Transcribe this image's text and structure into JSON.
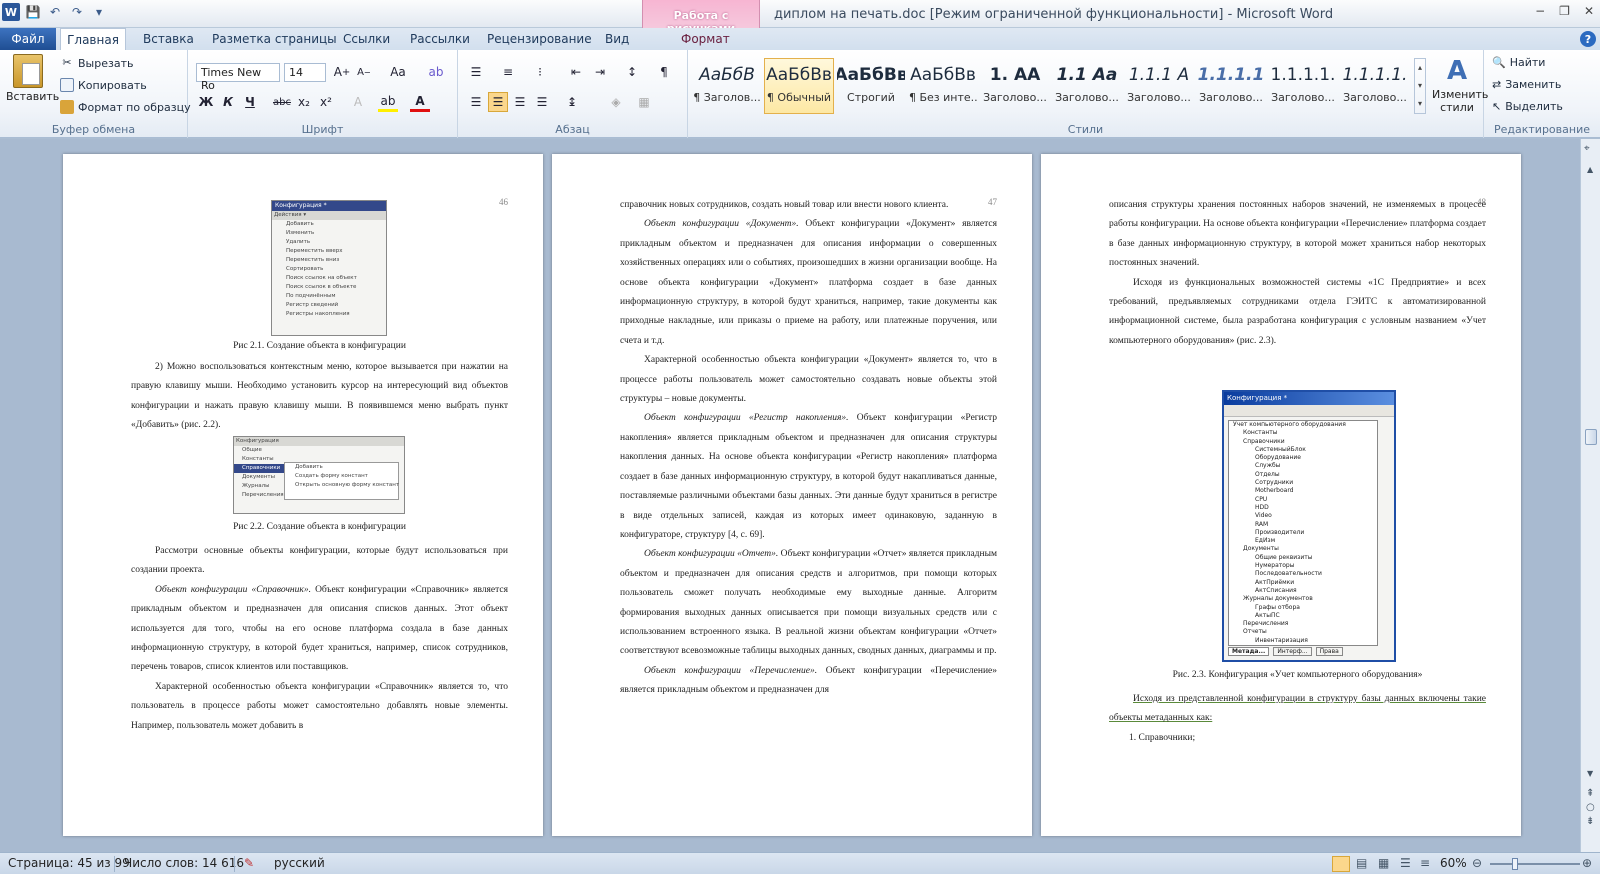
{
  "window": {
    "title": "диплом на печать.doc [Режим ограниченной функциональности]  -  Microsoft Word",
    "context_tab_group": "Работа с рисунками",
    "context_tab": "Формат",
    "controls": [
      "−",
      "❐",
      "✕"
    ]
  },
  "tabs": [
    "Файл",
    "Главная",
    "Вставка",
    "Разметка страницы",
    "Ссылки",
    "Рассылки",
    "Рецензирование",
    "Вид"
  ],
  "ribbon": {
    "clipboard": {
      "paste": "Вставить",
      "cut": "Вырезать",
      "copy": "Копировать",
      "format_painter": "Формат по образцу",
      "label": "Буфер обмена"
    },
    "font": {
      "name": "Times New Ro",
      "size": "14",
      "label": "Шрифт",
      "bold": "Ж",
      "italic": "К",
      "underline": "Ч",
      "strike": "abc",
      "sub": "x₂",
      "sup": "x²"
    },
    "paragraph": {
      "label": "Абзац"
    },
    "styles": {
      "label": "Стили",
      "items": [
        {
          "preview": "АаБбВ",
          "name": "¶ Заголов..."
        },
        {
          "preview": "АаБбВв",
          "name": "¶ Обычный"
        },
        {
          "preview": "АаБбВв",
          "name": "Строгий"
        },
        {
          "preview": "АаБбВв",
          "name": "¶ Без инте..."
        },
        {
          "preview": "1.  АА",
          "name": "Заголово..."
        },
        {
          "preview": "1.1  Аа",
          "name": "Заголово..."
        },
        {
          "preview": "1.1.1  А",
          "name": "Заголово..."
        },
        {
          "preview": "1.1.1.1",
          "name": "Заголово..."
        },
        {
          "preview": "1.1.1.1.",
          "name": "Заголово..."
        },
        {
          "preview": "1.1.1.1.",
          "name": "Заголово..."
        }
      ],
      "change": "Изменить стили"
    },
    "editing": {
      "find": "Найти",
      "replace": "Заменить",
      "select": "Выделить",
      "label": "Редактирование"
    }
  },
  "pages": [
    {
      "number": "46",
      "figure1_title": "Конфигурация *",
      "figure1_lines": [
        "Действия ▾",
        "Добавить",
        "Изменить",
        "Удалить",
        "Переместить вверх",
        "Переместить вниз",
        "Сортировать",
        "Поиск ссылок на объект",
        "Поиск ссылок в объекте",
        "По подчинённым",
        "Регистр сведений",
        "Регистры накопления"
      ],
      "caption1": "Рис 2.1. Создание объекта в конфигурации",
      "para1": "2) Можно воспользоваться контекстным меню, которое вызывается при нажатии на правую клавишу мыши. Необходимо установить курсор на интересующий вид объектов конфигурации и нажать правую клавишу мыши. В появившемся меню выбрать пункт «Добавить» (рис. 2.2).",
      "figure2_lines": [
        "Конфигурация",
        "Общие",
        "Константы",
        "Справочники",
        "Документы",
        "Журналы",
        "Перечисления"
      ],
      "figure2_menu": [
        "Добавить",
        "Создать форму констант",
        "Открыть основную форму констант"
      ],
      "caption2": "Рис 2.2. Создание объекта в конфигурации",
      "para2": "Рассмотри основные объекты конфигурации, которые будут использоваться при создании проекта.",
      "para3_italic": "Объект конфигурации «Справочник».",
      "para3": " Объект конфигурации «Справочник» является прикладным объектом и предназначен для описания списков данных. Этот объект используется для того, чтобы на его основе платформа создала в базе данных информационную структуру, в которой будет храниться, например, список сотрудников, перечень товаров, список клиентов или поставщиков.",
      "para4": "Характерной особенностью объекта конфигурации «Справочник» является то, что пользователь в процессе работы может самостоятельно добавлять новые элементы. Например, пользователь может добавить в"
    },
    {
      "number": "47",
      "para1": "справочник новых сотрудников, создать новый товар или внести нового клиента.",
      "para2_italic": "Объект конфигурации «Документ».",
      "para2": " Объект конфигурации «Документ» является прикладным объектом и предназначен для описания информации о совершенных хозяйственных операциях или о событиях, произошедших в жизни организации вообще. На основе объекта конфигурации «Документ» платформа создает в базе данных информационную структуру, в которой будут храниться, например, такие документы как приходные накладные, или приказы о приеме на работу, или платежные поручения, или счета и т.д.",
      "para3": "Характерной особенностью объекта конфигурации «Документ» является то, что в процессе работы пользователь может самостоятельно создавать новые объекты этой структуры – новые документы.",
      "para4_italic": "Объект конфигурации «Регистр накопления».",
      "para4": " Объект конфигурации «Регистр накопления» является прикладным объектом и предназначен для описания структуры накопления данных. На основе объекта конфигурации «Регистр накопления» платформа создает в базе данных информационную структуру, в которой будут накапливаться данные, поставляемые различными объектами базы данных. Эти данные будут храниться в регистре в виде отдельных записей, каждая из которых имеет одинаковую, заданную в конфигураторе, структуру [4, с. 69].",
      "para5_italic": "Объект конфигурации «Отчет».",
      "para5": " Объект конфигурации «Отчет» является прикладным объектом и предназначен для описания средств и алгоритмов, при помощи которых пользователь сможет получать необходимые ему выходные данные. Алгоритм формирования выходных данных описывается при помощи визуальных средств или с использованием встроенного языка. В реальной жизни объектам конфигурации «Отчет» соответствуют всевозможные таблицы выходных данных, сводных данных, диаграммы и пр.",
      "para6_italic": "Объект конфигурации «Перечисление».",
      "para6": " Объект конфигурации «Перечисление» является прикладным объектом и предназначен для"
    },
    {
      "number": "48",
      "para1": "описания структуры хранения постоянных наборов значений, не изменяемых в процессе работы конфигурации. На основе объекта конфигурации «Перечисление» платформа создает в базе данных информационную структуру, в которой может храниться набор некоторых постоянных значений.",
      "para2": "Исходя из функциональных возможностей системы «1С Предприятие» и всех требований, предъявляемых сотрудниками отдела ГЭИТС к автоматизированной информационной системе, была разработана конфигурация с условным названием «Учет компьютерного оборудования» (рис. 2.3).",
      "figure_title": "Конфигурация *",
      "tree": [
        "Учет компьютерного оборудования",
        "Константы",
        "Справочники",
        "СистемныйБлок",
        "Оборудование",
        "Службы",
        "Отделы",
        "Сотрудники",
        "Motherboard",
        "CPU",
        "HDD",
        "Video",
        "RAM",
        "Производители",
        "ЕдИзм",
        "Документы",
        "Общие реквизиты",
        "Нумераторы",
        "Последовательности",
        "АктПриёмки",
        "АктСписания",
        "Журналы документов",
        "Графы отбора",
        "АктыПС",
        "Перечисления",
        "Отчеты",
        "Инвентаризация"
      ],
      "figure_tabs": [
        "Метада...",
        "Интерф...",
        "Права"
      ],
      "caption": "Рис. 2.3. Конфигурация «Учет компьютерного оборудования»",
      "para3": "Исходя из представленной конфигурации в структуру базы данных включены такие объекты метаданных как:",
      "item1": "1. Справочники;"
    }
  ],
  "status": {
    "page": "Страница: 45 из 99",
    "words": "Число слов: 14 616",
    "language": "русский",
    "zoom": "60%"
  }
}
